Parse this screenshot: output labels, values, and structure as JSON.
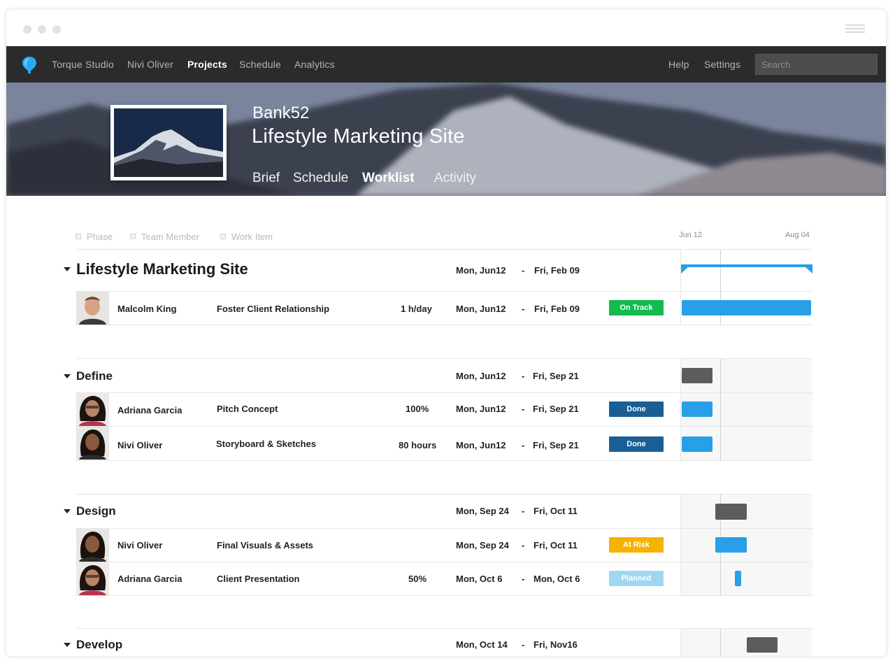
{
  "nav": {
    "items": [
      "Torque Studio",
      "Nivi Oliver",
      "Projects",
      "Schedule",
      "Analytics"
    ],
    "right_items": [
      "Help",
      "Settings"
    ],
    "search_placeholder": "Search"
  },
  "hero": {
    "client": "Bank52",
    "title": "Lifestyle Marketing Site",
    "tabs": [
      "Brief",
      "Schedule",
      "Worklist",
      "Activity"
    ],
    "active_tab": "Worklist"
  },
  "filters": [
    "Phase",
    "Team Member",
    "Work Item"
  ],
  "timeline": {
    "start_label": "Jun 12",
    "end_label": "Aug 04"
  },
  "project": {
    "title": "Lifestyle Marketing Site",
    "start": "Mon, Jun12",
    "end": "Fri, Feb 09"
  },
  "project_rows": [
    {
      "member": "Malcolm King",
      "item": "Foster Client Relationship",
      "effort": "1 h/day",
      "start": "Mon, Jun12",
      "end": "Fri, Feb 09",
      "status": "On Track",
      "status_color": "#12bb4e"
    }
  ],
  "phases": [
    {
      "title": "Define",
      "start": "Mon, Jun12",
      "end": "Fri, Sep 21",
      "rows": [
        {
          "member": "Adriana Garcia",
          "item": "Pitch Concept",
          "effort": "100%",
          "start": "Mon, Jun12",
          "end": "Fri, Sep 21",
          "status": "Done",
          "status_color": "#1a5e96"
        },
        {
          "member": "Nivi Oliver",
          "item": "Storyboard & Sketches",
          "effort": "80 hours",
          "start": "Mon, Jun12",
          "end": "Fri, Sep 21",
          "status": "Done",
          "status_color": "#1a5e96"
        }
      ]
    },
    {
      "title": "Design",
      "start": "Mon, Sep 24",
      "end": "Fri, Oct 11",
      "rows": [
        {
          "member": "Nivi Oliver",
          "item": "Final Visuals & Assets",
          "effort": "",
          "start": "Mon, Sep 24",
          "end": "Fri, Oct 11",
          "status": "At Risk",
          "status_color": "#f5b300"
        },
        {
          "member": "Adriana Garcia",
          "item": "Client Presentation",
          "effort": "50%",
          "start": "Mon, Oct 6",
          "end": "Mon, Oct 6",
          "status": "Planned",
          "status_color": "#9fd7f2"
        }
      ]
    },
    {
      "title": "Develop",
      "start": "Mon, Oct 14",
      "end": "Fri, Nov16",
      "rows": []
    }
  ],
  "date_separator": "-",
  "colors": {
    "accent": "#27a0e8",
    "nav_bg": "#2b2b2b",
    "phase_bar": "#5c5c5c"
  }
}
